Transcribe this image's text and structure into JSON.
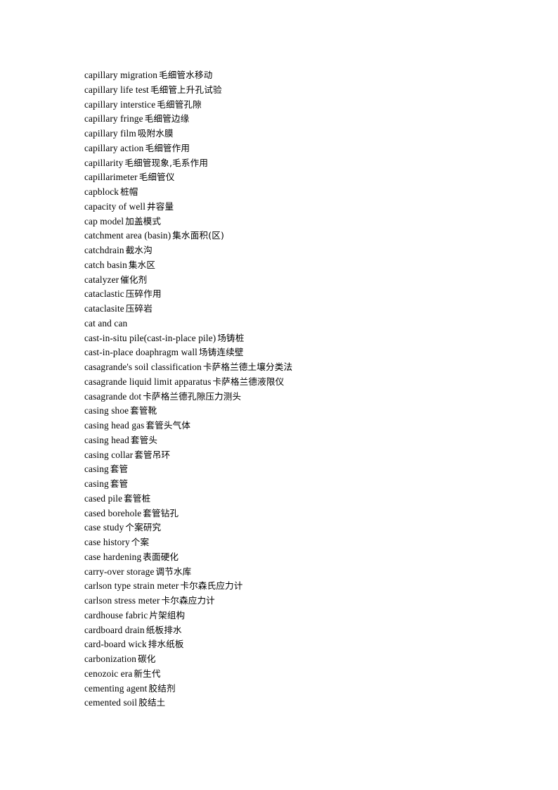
{
  "document": {
    "type": "glossary-page",
    "language_pair": "English-Chinese",
    "background_color": "#ffffff",
    "text_color": "#000000",
    "entry_count": 44,
    "entries": [
      {
        "term": "capillary migration",
        "gloss": "毛细管水移动"
      },
      {
        "term": "capillary life test",
        "gloss": "毛细管上升孔试验"
      },
      {
        "term": "capillary interstice",
        "gloss": "毛细管孔隙"
      },
      {
        "term": "capillary fringe",
        "gloss": "毛细管边缘"
      },
      {
        "term": "capillary film",
        "gloss": "吸附水膜"
      },
      {
        "term": "capillary action",
        "gloss": "毛细管作用"
      },
      {
        "term": "capillarity",
        "gloss": "毛细管现象,毛系作用"
      },
      {
        "term": "capillarimeter",
        "gloss": "毛细管仪"
      },
      {
        "term": "capblock",
        "gloss": "桩帽"
      },
      {
        "term": "capacity of well",
        "gloss": "井容量"
      },
      {
        "term": "cap model",
        "gloss": "加盖模式"
      },
      {
        "term": "catchment area (basin)",
        "gloss": "集水面积(区)"
      },
      {
        "term": "catchdrain",
        "gloss": "截水沟"
      },
      {
        "term": "catch basin",
        "gloss": "集水区"
      },
      {
        "term": "catalyzer",
        "gloss": "催化剂"
      },
      {
        "term": "cataclastic",
        "gloss": "压碎作用"
      },
      {
        "term": "cataclasite",
        "gloss": "压碎岩"
      },
      {
        "term": "cat and can",
        "gloss": ""
      },
      {
        "term": "cast-in-situ pile(cast-in-place pile)",
        "gloss": "场铸桩"
      },
      {
        "term": "cast-in-place doaphragm wall",
        "gloss": "场铸连续壁"
      },
      {
        "term": "casagrande's soil classification",
        "gloss": "卡萨格兰德土壤分类法"
      },
      {
        "term": "casagrande liquid limit apparatus",
        "gloss": "卡萨格兰德液限仪"
      },
      {
        "term": "casagrande dot",
        "gloss": "卡萨格兰德孔隙压力测头"
      },
      {
        "term": "casing shoe",
        "gloss": "套管靴"
      },
      {
        "term": "casing head gas",
        "gloss": "套管头气体"
      },
      {
        "term": "casing head",
        "gloss": "套管头"
      },
      {
        "term": "casing collar",
        "gloss": "套管吊环"
      },
      {
        "term": "casing",
        "gloss": "套管"
      },
      {
        "term": "casing",
        "gloss": "套管"
      },
      {
        "term": "cased pile",
        "gloss": "套管桩"
      },
      {
        "term": "cased borehole",
        "gloss": "套管钻孔"
      },
      {
        "term": "case study",
        "gloss": "个案研究"
      },
      {
        "term": "case history",
        "gloss": "个案"
      },
      {
        "term": "case hardening",
        "gloss": "表面硬化"
      },
      {
        "term": "carry-over storage",
        "gloss": "调节水库"
      },
      {
        "term": "carlson type strain meter",
        "gloss": "卡尔森氏应力计"
      },
      {
        "term": "carlson stress meter",
        "gloss": "卡尔森应力计"
      },
      {
        "term": "cardhouse fabric",
        "gloss": "片架组构"
      },
      {
        "term": "cardboard drain",
        "gloss": "纸板排水"
      },
      {
        "term": "card-board wick",
        "gloss": "排水纸板"
      },
      {
        "term": "carbonization",
        "gloss": "碳化"
      },
      {
        "term": "cenozoic era",
        "gloss": "新生代"
      },
      {
        "term": "cementing agent",
        "gloss": "胶结剂"
      },
      {
        "term": "cemented soil",
        "gloss": "胶结土"
      }
    ]
  }
}
